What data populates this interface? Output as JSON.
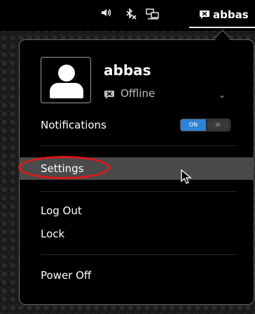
{
  "panel": {
    "volume_icon": "volume-icon",
    "bluetooth_icon": "bluetooth-disabled-icon",
    "network_icon": "network-wired-icon",
    "user_icon": "im-user-offline-icon",
    "username": "abbas"
  },
  "menu": {
    "avatar_icon": "user-avatar-icon",
    "name": "abbas",
    "status": {
      "icon": "offline-icon",
      "text": "Offline"
    },
    "notifications": {
      "label": "Notifications",
      "toggle_on": "ON",
      "toggle_off": "III"
    },
    "settings_label": "Settings",
    "logout_label": "Log Out",
    "lock_label": "Lock",
    "power_label": "Power Off"
  },
  "colors": {
    "toggle_accent": "#2f84d8",
    "highlight_bg": "#4a4a4a",
    "annotation_red": "#e01818"
  }
}
